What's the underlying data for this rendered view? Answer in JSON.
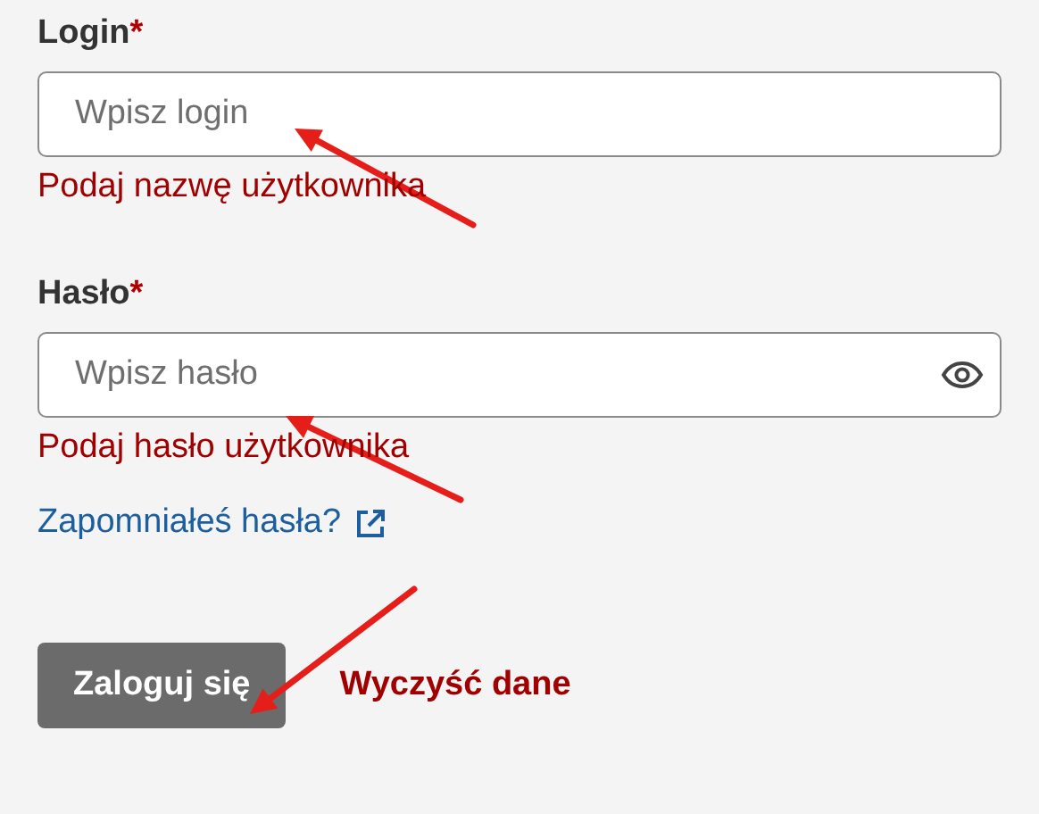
{
  "fields": [
    {
      "kind": "text",
      "label": "Login",
      "required_mark": "*",
      "placeholder": "Wpisz login",
      "error": "Podaj nazwę użytkownika"
    },
    {
      "kind": "password",
      "label": "Hasło",
      "required_mark": "*",
      "placeholder": "Wpisz hasło",
      "error": "Podaj hasło użytkownika"
    }
  ],
  "forgot_link": "Zapomniałeś hasła?",
  "buttons": [
    {
      "kind": "primary",
      "label": "Zaloguj się"
    },
    {
      "kind": "text",
      "label": "Wyczyść dane"
    }
  ]
}
